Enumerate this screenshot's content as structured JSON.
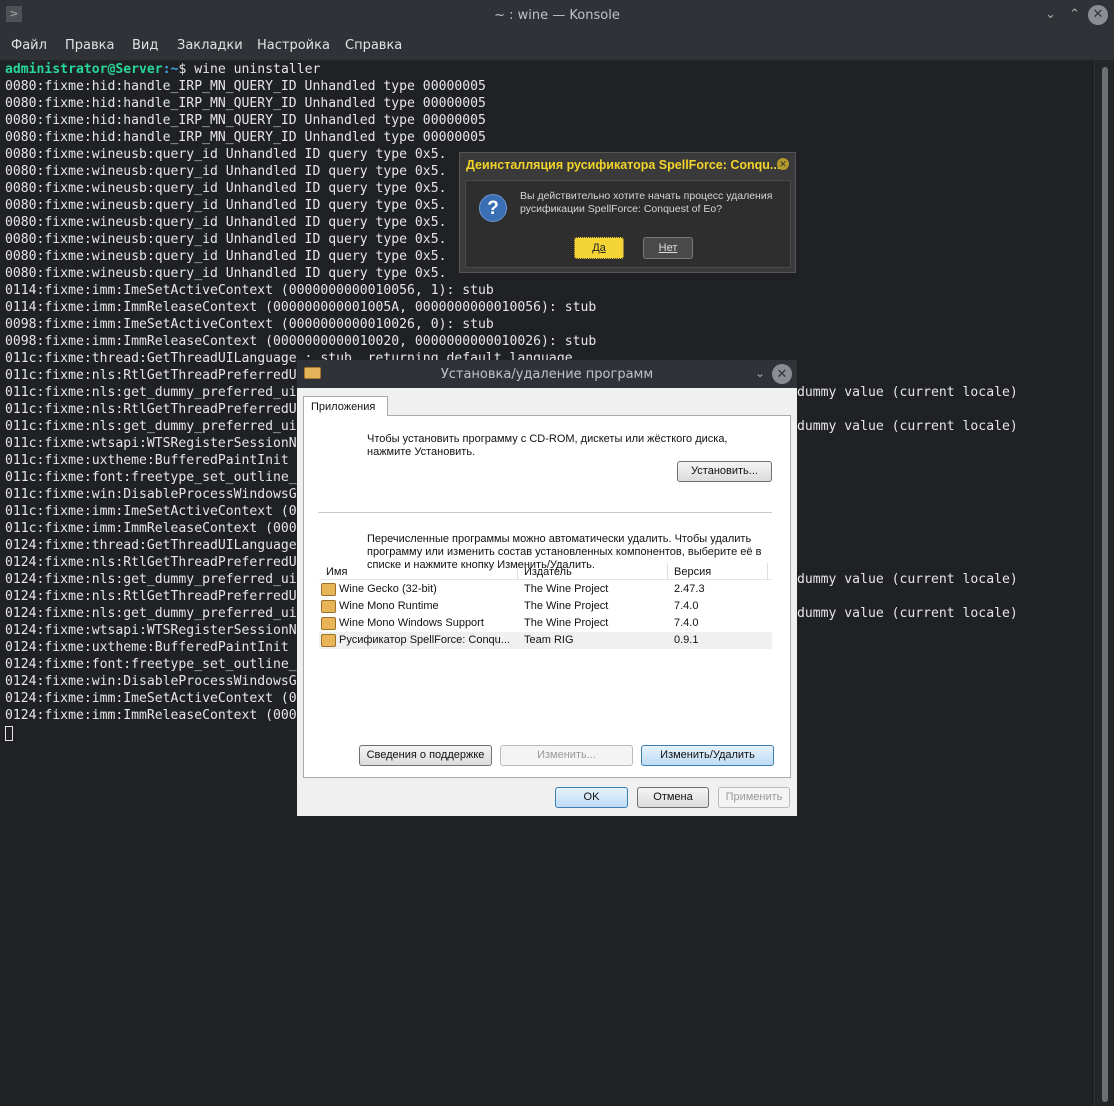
{
  "window": {
    "title": "~ : wine — Konsole"
  },
  "menu": [
    "Файл",
    "Правка",
    "Вид",
    "Закладки",
    "Настройка",
    "Справка"
  ],
  "prompt": {
    "user_host": "administrator@Server",
    "path": ":~",
    "symbol": "$",
    "command": " wine uninstaller"
  },
  "terminal_lines": [
    {
      "text": "0080:fixme:hid:handle_IRP_MN_QUERY_ID Unhandled type 00000005"
    },
    {
      "text": "0080:fixme:hid:handle_IRP_MN_QUERY_ID Unhandled type 00000005"
    },
    {
      "text": "0080:fixme:hid:handle_IRP_MN_QUERY_ID Unhandled type 00000005"
    },
    {
      "text": "0080:fixme:hid:handle_IRP_MN_QUERY_ID Unhandled type 00000005"
    },
    {
      "text": "0080:fixme:wineusb:query_id Unhandled ID query type 0x5."
    },
    {
      "text": "0080:fixme:wineusb:query_id Unhandled ID query type 0x5."
    },
    {
      "text": "0080:fixme:wineusb:query_id Unhandled ID query type 0x5."
    },
    {
      "text": "0080:fixme:wineusb:query_id Unhandled ID query type 0x5."
    },
    {
      "text": "0080:fixme:wineusb:query_id Unhandled ID query type 0x5."
    },
    {
      "text": "0080:fixme:wineusb:query_id Unhandled ID query type 0x5."
    },
    {
      "text": "0080:fixme:wineusb:query_id Unhandled ID query type 0x5."
    },
    {
      "text": "0080:fixme:wineusb:query_id Unhandled ID query type 0x5."
    },
    {
      "text": "0114:fixme:imm:ImeSetActiveContext (0000000000010056, 1): stub"
    },
    {
      "text": "0114:fixme:imm:ImmReleaseContext (000000000001005A, 0000000000010056): stub"
    },
    {
      "text": "0098:fixme:imm:ImeSetActiveContext (0000000000010026, 0): stub"
    },
    {
      "text": "0098:fixme:imm:ImmReleaseContext (0000000000010020, 0000000000010026): stub"
    },
    {
      "text": "011c:fixme:thread:GetThreadUILanguage : stub, returning default language."
    },
    {
      "text": "011c:fixme:nls:RtlGetThreadPreferredU"
    },
    {
      "text": "011c:fixme:nls:get_dummy_preferred_ui",
      "tail": "dummy value (current locale)"
    },
    {
      "text": "011c:fixme:nls:RtlGetThreadPreferredU"
    },
    {
      "text": "011c:fixme:nls:get_dummy_preferred_ui",
      "tail": "dummy value (current locale)"
    },
    {
      "text": "011c:fixme:wtsapi:WTSRegisterSessionN"
    },
    {
      "text": "011c:fixme:uxtheme:BufferedPaintInit"
    },
    {
      "text": "011c:fixme:font:freetype_set_outline_"
    },
    {
      "text": "011c:fixme:win:DisableProcessWindowsG"
    },
    {
      "text": "011c:fixme:imm:ImeSetActiveContext (0"
    },
    {
      "text": "011c:fixme:imm:ImmReleaseContext (000"
    },
    {
      "text": "0124:fixme:thread:GetThreadUILanguage"
    },
    {
      "text": "0124:fixme:nls:RtlGetThreadPreferredU"
    },
    {
      "text": "0124:fixme:nls:get_dummy_preferred_ui",
      "tail": "dummy value (current locale)"
    },
    {
      "text": "0124:fixme:nls:RtlGetThreadPreferredU"
    },
    {
      "text": "0124:fixme:nls:get_dummy_preferred_ui",
      "tail": "dummy value (current locale)"
    },
    {
      "text": "0124:fixme:wtsapi:WTSRegisterSessionN"
    },
    {
      "text": "0124:fixme:uxtheme:BufferedPaintInit"
    },
    {
      "text": "0124:fixme:font:freetype_set_outline_"
    },
    {
      "text": "0124:fixme:win:DisableProcessWindowsG"
    },
    {
      "text": "0124:fixme:imm:ImeSetActiveContext (0"
    },
    {
      "text": "0124:fixme:imm:ImmReleaseContext (000"
    }
  ],
  "confirm_dialog": {
    "title": "Деинсталляция русификатора SpellForce: Conqu...",
    "message": "Вы действительно хотите начать процесс удаления русификации SpellForce: Conquest of Eo?",
    "yes": "Да",
    "no": "Нет",
    "accent": "#f5d535"
  },
  "programs_dialog": {
    "title": "Установка/удаление программ",
    "tab": "Приложения",
    "install_text": "Чтобы установить программу с CD-ROM, дискеты или жёсткого диска, нажмите Установить.",
    "install_button": "Установить...",
    "remove_text": "Перечисленные программы можно автоматически удалить. Чтобы удалить программу или изменить состав установленных компонентов, выберите её в списке и нажмите кнопку Изменить/Удалить.",
    "columns": [
      "Имя",
      "Издатель",
      "Версия"
    ],
    "rows": [
      {
        "name": "Wine Gecko (32-bit)",
        "publisher": "The Wine Project",
        "version": "2.47.3"
      },
      {
        "name": "Wine Mono Runtime",
        "publisher": "The Wine Project",
        "version": "7.4.0"
      },
      {
        "name": "Wine Mono Windows Support",
        "publisher": "The Wine Project",
        "version": "7.4.0"
      },
      {
        "name": "Русификатор SpellForce: Conqu...",
        "publisher": "Team RIG",
        "version": "0.9.1"
      }
    ],
    "support_button": "Сведения о поддержке",
    "modify_button": "Изменить...",
    "modify_remove_button": "Изменить/Удалить",
    "ok": "OK",
    "cancel": "Отмена",
    "apply": "Применить"
  }
}
